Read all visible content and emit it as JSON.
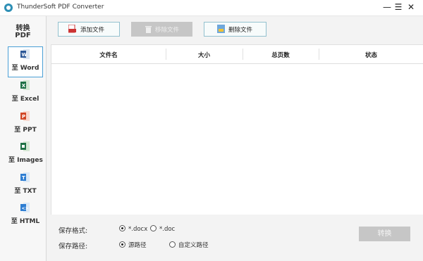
{
  "window": {
    "title": "ThunderSoft PDF Converter",
    "minimize": "—",
    "maximize": "☰",
    "close": "✕"
  },
  "sidebar": {
    "heading_line1": "转换",
    "heading_line2": "PDF",
    "items": [
      {
        "label": "至 Word",
        "icon": "word-icon",
        "color": "#2b5797"
      },
      {
        "label": "至 Excel",
        "icon": "excel-icon",
        "color": "#1e7145"
      },
      {
        "label": "至 PPT",
        "icon": "ppt-icon",
        "color": "#d24726"
      },
      {
        "label": "至 Images",
        "icon": "images-icon",
        "color": "#1e7145"
      },
      {
        "label": "至 TXT",
        "icon": "txt-icon",
        "color": "#2d7dd2"
      },
      {
        "label": "至 HTML",
        "icon": "html-icon",
        "color": "#2d7dd2"
      }
    ]
  },
  "toolbar": {
    "add_label": "添加文件",
    "remove_label": "移除文件",
    "delete_label": "删除文件"
  },
  "table": {
    "columns": [
      "文件名",
      "大小",
      "总页数",
      "状态"
    ]
  },
  "settings": {
    "format_label": "保存格式:",
    "format_options": [
      "*.docx",
      "*.doc"
    ],
    "format_selected": "*.docx",
    "path_label": "保存路径:",
    "path_options": [
      "源路径",
      "自定义路径"
    ],
    "path_selected": "源路径",
    "convert_label": "转换"
  },
  "colors": {
    "accent_border": "#4a9fd6",
    "disabled_button": "#c6c6c6"
  }
}
